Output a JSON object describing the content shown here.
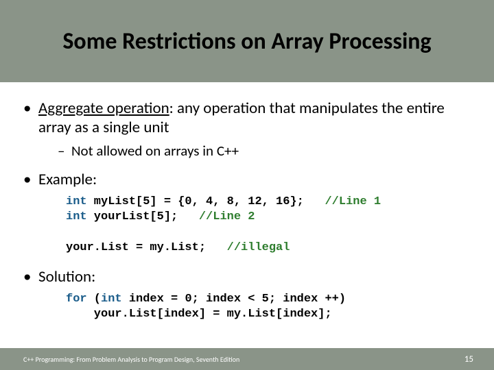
{
  "title": "Some Restrictions on Array Processing",
  "bullet1_term": "Aggregate operation",
  "bullet1_rest": ": any operation that manipulates the entire array as a single unit",
  "sub1": "Not allowed on arrays in C++",
  "bullet2": "Example:",
  "code_example": {
    "l1a": "int",
    "l1b": " myList[5] = {0, 4, 8, 12, 16};   ",
    "l1c": "//Line 1",
    "l2a": "int",
    "l2b": " yourList[5];   ",
    "l2c": "//Line 2",
    "l3a": "your.List = my.List;   ",
    "l3b": "//illegal"
  },
  "bullet3": "Solution:",
  "code_solution": {
    "l1a": "for",
    "l1b": " (",
    "l1c": "int",
    "l1d": " index = 0; index < 5; index ++)",
    "l2": "    your.List[index] = my.List[index];"
  },
  "footer": "C++ Programming: From Problem Analysis to Program Design, Seventh Edition",
  "page": "15"
}
